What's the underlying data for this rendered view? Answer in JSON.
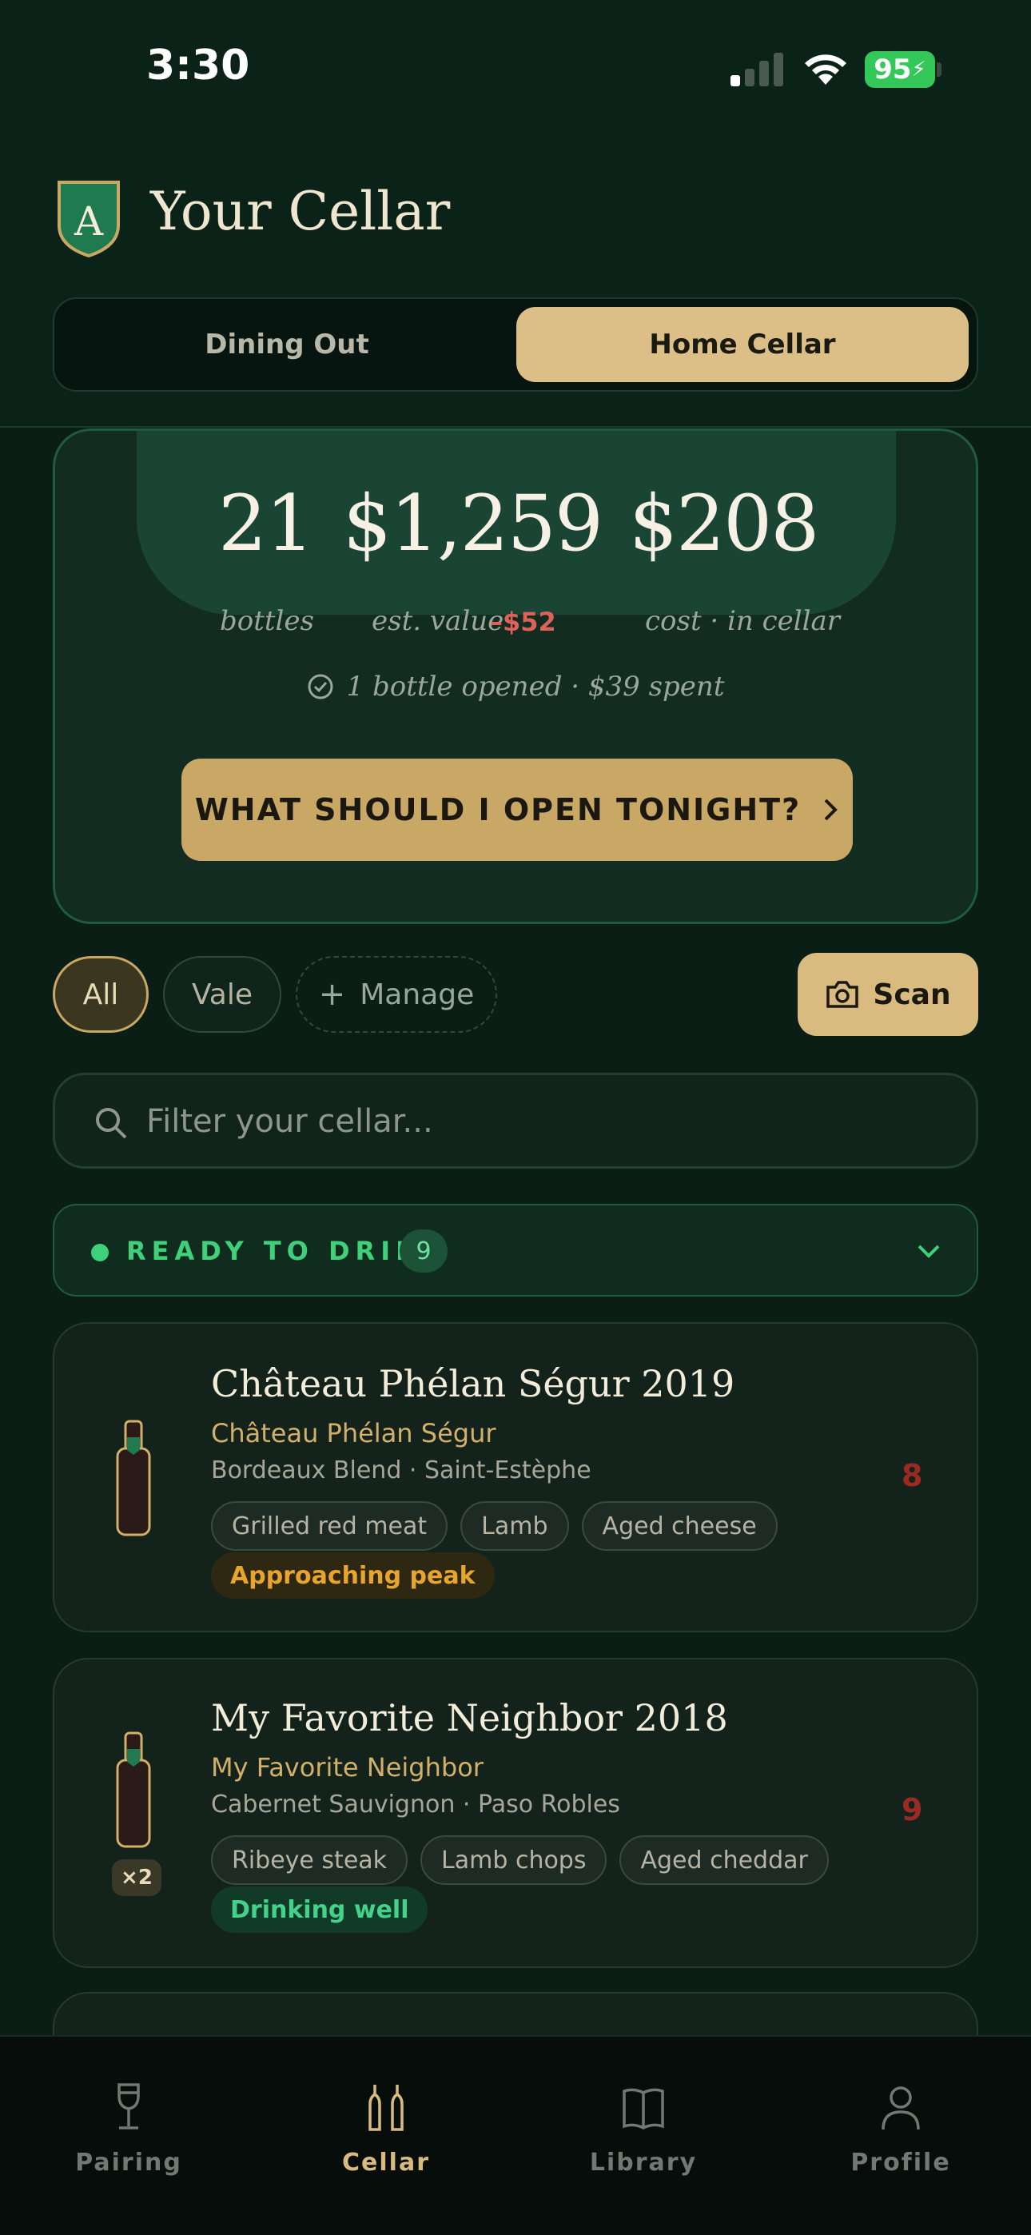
{
  "status_bar": {
    "time": "3:30",
    "battery": "95"
  },
  "header": {
    "title": "Your Cellar",
    "logo_letter": "A",
    "segments": [
      "Dining Out",
      "Home Cellar"
    ],
    "active_segment": "Home Cellar"
  },
  "stats": {
    "bottles_value": "21",
    "bottles_label": "bottles",
    "est_value": "$1,259",
    "est_value_label": "est. value",
    "est_value_delta": "–$52",
    "cost_value": "$208",
    "cost_label": "cost · in cellar",
    "opened_text": "1 bottle opened · $39 spent",
    "cta_label": "WHAT SHOULD I OPEN TONIGHT?"
  },
  "filters": {
    "chips": [
      "All",
      "Vale"
    ],
    "active_chip": "All",
    "manage_label": "Manage",
    "scan_label": "Scan"
  },
  "search": {
    "placeholder": "Filter your cellar..."
  },
  "section": {
    "title": "READY TO DRINK",
    "count": "9"
  },
  "wines": [
    {
      "name": "Château Phélan Ségur 2019",
      "producer": "Château Phélan Ségur",
      "subtitle": "Bordeaux Blend · Saint-Estèphe",
      "pairings": [
        "Grilled red meat",
        "Lamb",
        "Aged cheese"
      ],
      "status": "Approaching peak",
      "score": "8",
      "quantity": ""
    },
    {
      "name": "My Favorite Neighbor 2018",
      "producer": "My Favorite Neighbor",
      "subtitle": "Cabernet Sauvignon · Paso Robles",
      "pairings": [
        "Ribeye steak",
        "Lamb chops",
        "Aged cheddar"
      ],
      "status": "Drinking well",
      "score": "9",
      "quantity": "×2"
    }
  ],
  "tabbar": {
    "tabs": [
      "Pairing",
      "Cellar",
      "Library",
      "Profile"
    ],
    "active_tab": "Cellar"
  },
  "colors": {
    "background": "#0a1e16",
    "accent_gold": "#d9bb80",
    "ready_green": "#3fd07a",
    "negative_red": "#e0605a"
  }
}
